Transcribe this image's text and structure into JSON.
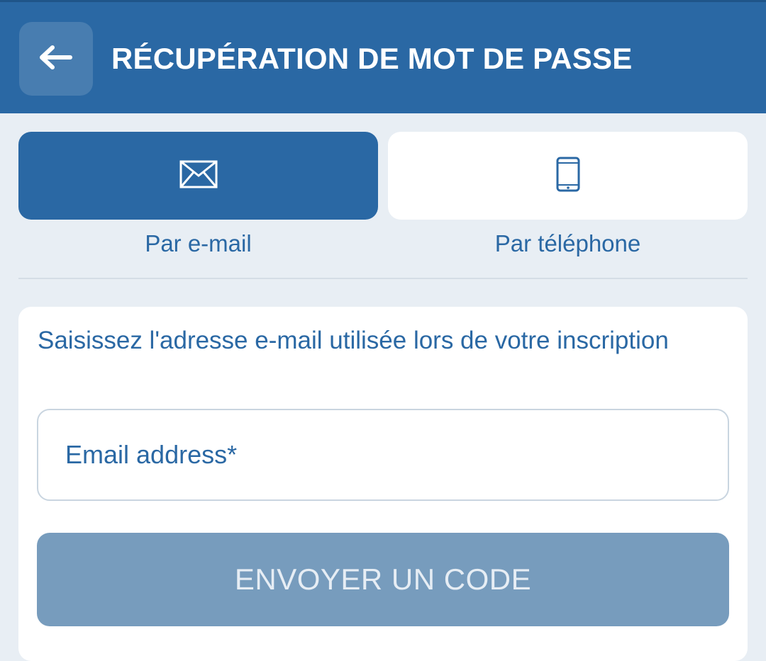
{
  "header": {
    "title": "RÉCUPÉRATION DE MOT DE PASSE",
    "back_icon": "arrow-left-icon"
  },
  "methods": [
    {
      "label": "Par e-mail",
      "icon": "envelope-icon",
      "active": true
    },
    {
      "label": "Par téléphone",
      "icon": "smartphone-icon",
      "active": false
    }
  ],
  "form": {
    "instruction": "Saisissez l'adresse e-mail utilisée lors de votre inscription",
    "email_placeholder": "Email address*",
    "email_value": "",
    "submit_label": "ENVOYER UN CODE",
    "submit_enabled": false
  },
  "colors": {
    "primary": "#2a68a4",
    "background": "#e8eef4",
    "button_disabled": "#779cbd"
  }
}
